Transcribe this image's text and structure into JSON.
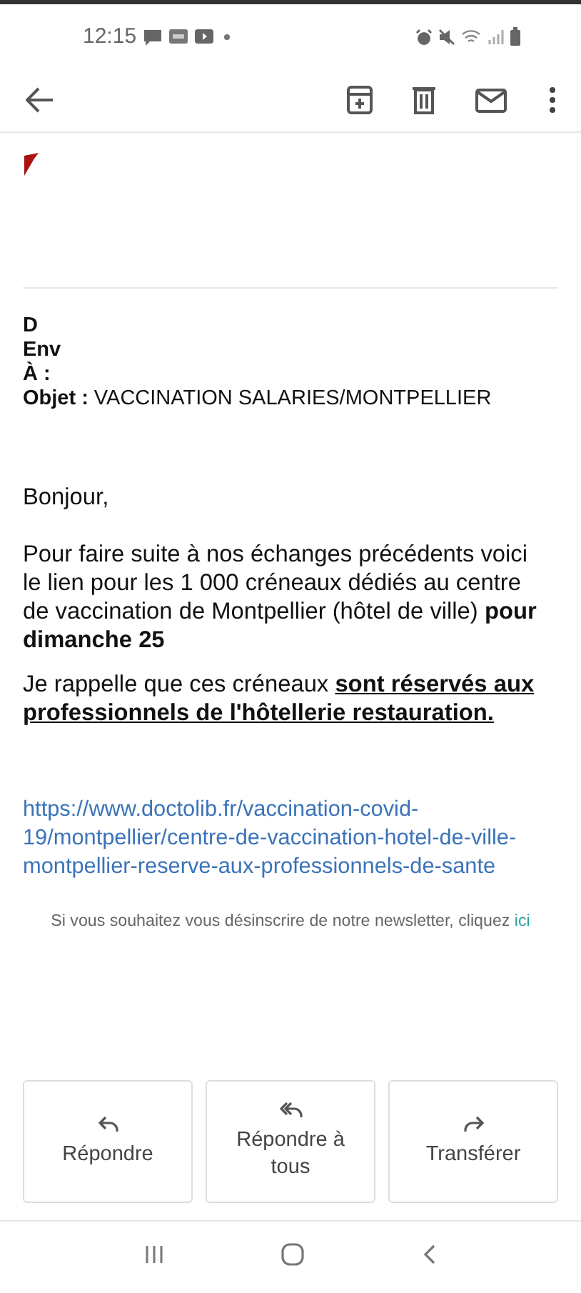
{
  "status_bar": {
    "time": "12:15"
  },
  "header": {
    "from_label": "D",
    "sent_label": "Env",
    "to_label": "À :",
    "subject_label": "Objet :",
    "subject": "VACCINATION SALARIES/MONTPELLIER"
  },
  "body": {
    "greeting": "Bonjour,",
    "paragraphs": [
      {
        "text": "Pour faire suite à nos échanges précédents voici le lien pour les 1 000 créneaux dédiés au centre de vaccination de Montpellier (hôtel de ville) **pour dimanche 25**",
        "bold_underlined": false
      },
      {
        "text": "Je rappelle que ces créneaux **sont réservés aux professionnels de l'hôtellerie restauration.**",
        "bold_underlined": true
      }
    ],
    "link": "https://www.doctolib.fr/vaccination-covid-19/montpellier/centre-de-vaccination-hotel-de-ville-montpellier-reserve-aux-professionnels-de-sante",
    "unsubscribe": "Si vous souhaitez vous désinscrire de notre newsletter, cliquez",
    "unsubscribe_link": "ici"
  },
  "actions": [
    {
      "kind": "reply",
      "label": "Répondre"
    },
    {
      "kind": "reply_all",
      "label": "Répondre à tous"
    },
    {
      "kind": "forward",
      "label": "Transférer"
    }
  ]
}
